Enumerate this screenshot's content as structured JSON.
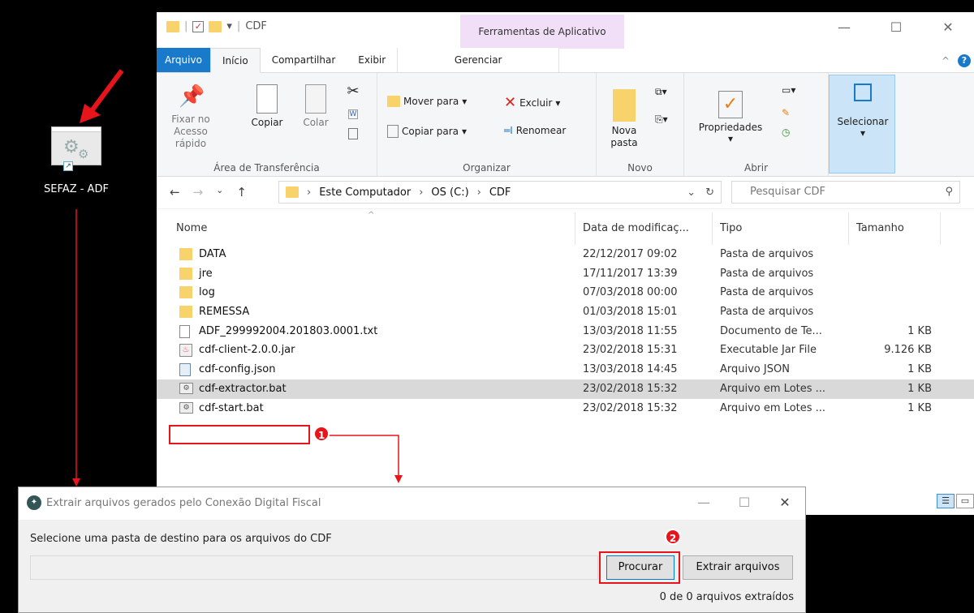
{
  "desktop": {
    "icon_label": "SEFAZ - ADF"
  },
  "explorer": {
    "title": "CDF",
    "context_tab_title": "Ferramentas de Aplicativo",
    "tabs": {
      "file": "Arquivo",
      "home": "Início",
      "share": "Compartilhar",
      "view": "Exibir",
      "manage": "Gerenciar"
    },
    "ribbon": {
      "clipboard": {
        "label": "Área de Transferência",
        "pin": "Fixar no Acesso rápido",
        "copy": "Copiar",
        "paste": "Colar"
      },
      "organize": {
        "label": "Organizar",
        "move_to": "Mover para",
        "copy_to": "Copiar para",
        "delete": "Excluir",
        "rename": "Renomear"
      },
      "new": {
        "label": "Novo",
        "new_folder": "Nova pasta"
      },
      "open": {
        "label": "Abrir",
        "properties": "Propriedades"
      },
      "select": {
        "label": "Selecionar"
      }
    },
    "breadcrumbs": [
      "Este Computador",
      "OS (C:)",
      "CDF"
    ],
    "search_placeholder": "Pesquisar CDF",
    "columns": {
      "name": "Nome",
      "date": "Data de modificaç...",
      "type": "Tipo",
      "size": "Tamanho"
    },
    "files": [
      {
        "name": "DATA",
        "date": "22/12/2017 09:02",
        "type": "Pasta de arquivos",
        "size": "",
        "icon": "folder-icon"
      },
      {
        "name": "jre",
        "date": "17/11/2017 13:39",
        "type": "Pasta de arquivos",
        "size": "",
        "icon": "folder-icon"
      },
      {
        "name": "log",
        "date": "07/03/2018 00:00",
        "type": "Pasta de arquivos",
        "size": "",
        "icon": "folder-icon"
      },
      {
        "name": "REMESSA",
        "date": "01/03/2018 15:01",
        "type": "Pasta de arquivos",
        "size": "",
        "icon": "folder-icon"
      },
      {
        "name": "ADF_299992004.201803.0001.txt",
        "date": "13/03/2018 11:55",
        "type": "Documento de Te...",
        "size": "1 KB",
        "icon": "text-file-icon"
      },
      {
        "name": "cdf-client-2.0.0.jar",
        "date": "23/02/2018 15:31",
        "type": "Executable Jar File",
        "size": "9.126 KB",
        "icon": "jar-file-icon"
      },
      {
        "name": "cdf-config.json",
        "date": "13/03/2018 14:45",
        "type": "Arquivo JSON",
        "size": "1 KB",
        "icon": "json-file-icon"
      },
      {
        "name": "cdf-extractor.bat",
        "date": "23/02/2018 15:32",
        "type": "Arquivo em Lotes ...",
        "size": "1 KB",
        "icon": "batch-file-icon"
      },
      {
        "name": "cdf-start.bat",
        "date": "23/02/2018 15:32",
        "type": "Arquivo em Lotes ...",
        "size": "1 KB",
        "icon": "batch-file-icon"
      }
    ],
    "selected_file": "cdf-extractor.bat"
  },
  "dialog": {
    "title": "Extrair arquivos gerados pelo Conexão Digital Fiscal",
    "prompt": "Selecione uma pasta de destino para os arquivos do CDF",
    "path_value": "",
    "browse_button": "Procurar",
    "extract_button": "Extrair arquivos",
    "status": "0 de 0 arquivos extraídos"
  },
  "annotations": {
    "step1": "1",
    "step2": "2",
    "accent_color": "#e8141c"
  }
}
